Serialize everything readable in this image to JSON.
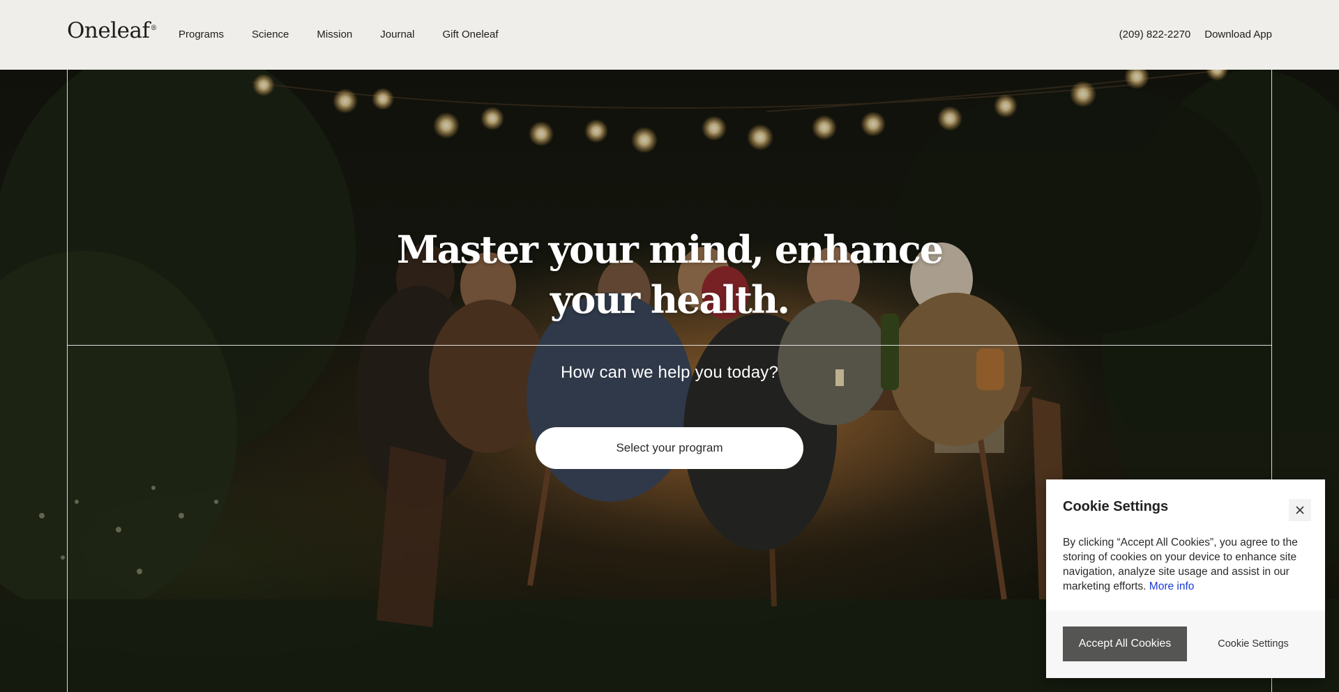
{
  "header": {
    "logo": "Oneleaf",
    "logo_mark": "®",
    "nav": [
      "Programs",
      "Science",
      "Mission",
      "Journal",
      "Gift Oneleaf"
    ],
    "phone": "(209) 822-2270",
    "download": "Download App"
  },
  "hero": {
    "headline_line1": "Master your mind, enhance",
    "headline_line2": "your health.",
    "subhead": "How can we help you today?",
    "cta": "Select your program"
  },
  "cookie": {
    "title": "Cookie Settings",
    "body": "By clicking “Accept All Cookies”, you agree to the storing of cookies on your device to enhance site navigation, analyze site usage and assist in our marketing efforts.",
    "more_info": "More info",
    "accept": "Accept All Cookies",
    "settings": "Cookie Settings"
  },
  "colors": {
    "header_bg": "#efeeea",
    "accept_bg": "#555653",
    "link": "#1a3ad6"
  },
  "icons": {
    "close": "close-icon"
  }
}
